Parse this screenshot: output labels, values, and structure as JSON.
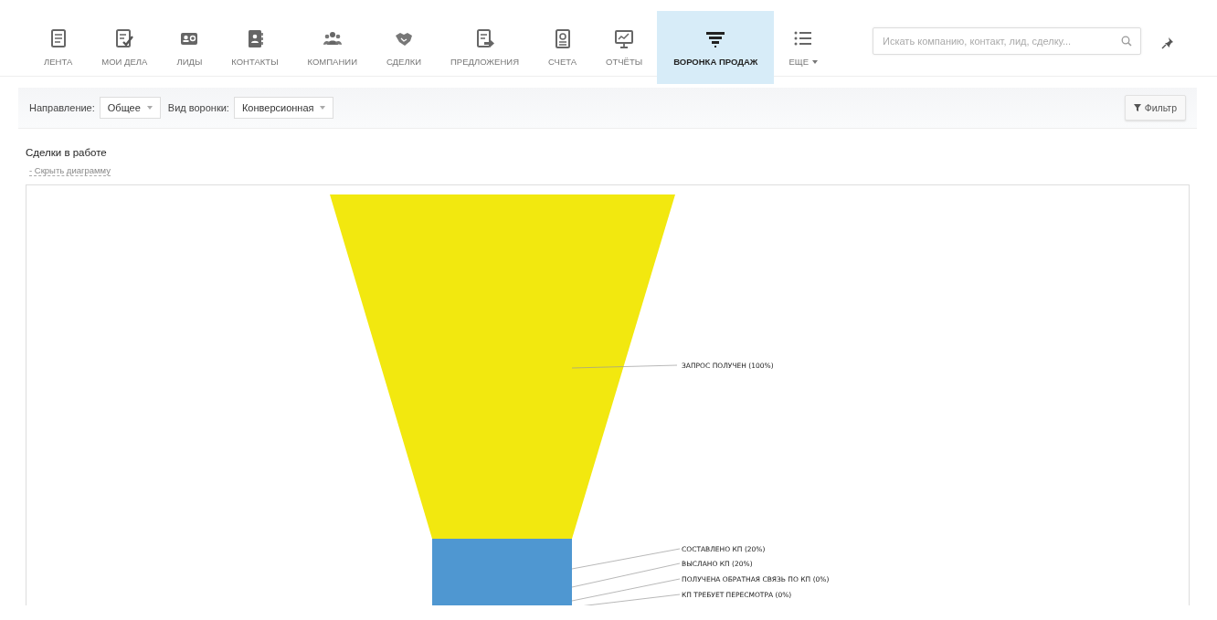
{
  "nav": {
    "items": [
      {
        "label": "ЛЕНТА",
        "selected": false
      },
      {
        "label": "МОИ ДЕЛА",
        "selected": false
      },
      {
        "label": "ЛИДЫ",
        "selected": false
      },
      {
        "label": "КОНТАКТЫ",
        "selected": false
      },
      {
        "label": "КОМПАНИИ",
        "selected": false
      },
      {
        "label": "СДЕЛКИ",
        "selected": false
      },
      {
        "label": "ПРЕДЛОЖЕНИЯ",
        "selected": false
      },
      {
        "label": "СЧЕТА",
        "selected": false
      },
      {
        "label": "ОТЧЁТЫ",
        "selected": false
      },
      {
        "label": "ВОРОНКА ПРОДАЖ",
        "selected": true
      },
      {
        "label": "ЕЩЕ",
        "selected": false
      }
    ],
    "search": {
      "placeholder": "Искать компанию, контакт, лид, сделку..."
    }
  },
  "filters": {
    "fields": [
      {
        "label": "Направление:",
        "value": "Общее"
      },
      {
        "label": "Вид воронки:",
        "value": "Конверсионная"
      }
    ],
    "filter_button": "Фильтр"
  },
  "section_title": "Сделки в работе",
  "toggle_link": "- Скрыть диаграмму",
  "funnel": {
    "stages": [
      {
        "label": "ЗАПРОС ПОЛУЧЕН (100%)",
        "color": "#f2e80f"
      },
      {
        "label": "СОСТАВЛЕНО КП (20%)",
        "color": "#4f97d1"
      },
      {
        "label": "ВЫСЛАНО КП (20%)"
      },
      {
        "label": "ПОЛУЧЕНА ОБРАТНАЯ СВЯЗЬ ПО КП (0%)"
      },
      {
        "label": "КП ТРЕБУЕТ ПЕРЕСМОТРА (0%)"
      }
    ]
  }
}
